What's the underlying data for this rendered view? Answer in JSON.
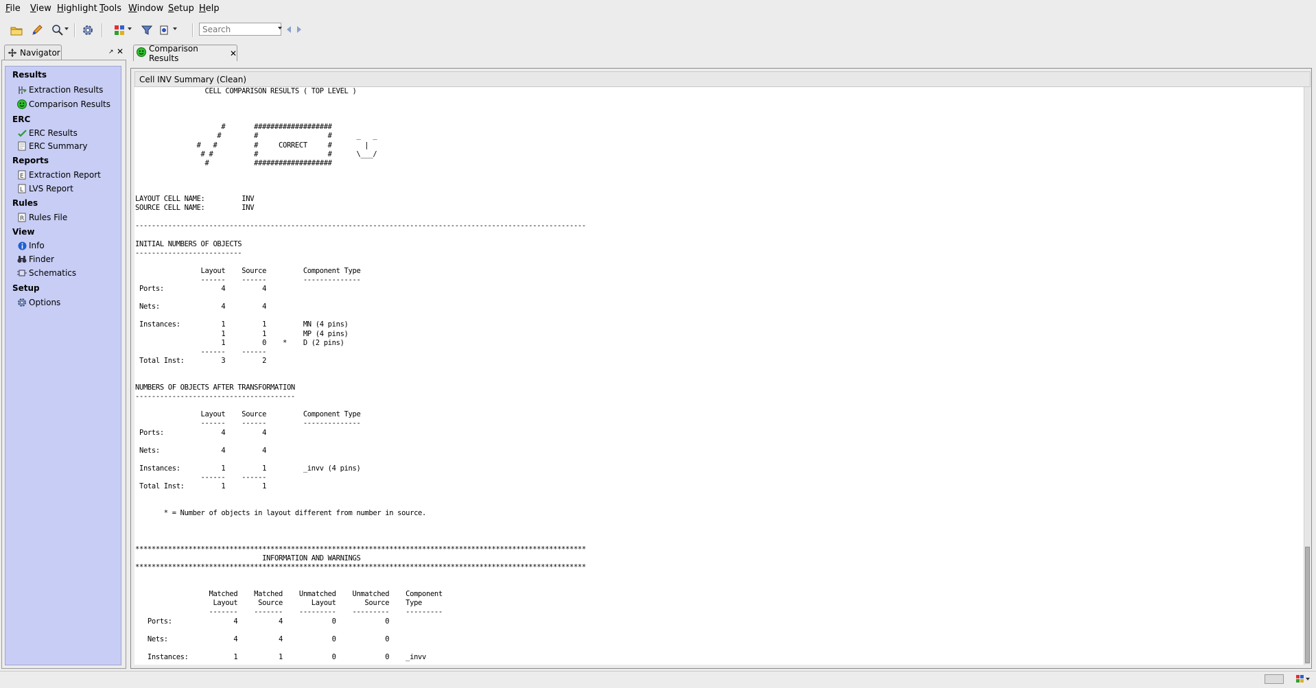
{
  "menubar": {
    "items": [
      {
        "pre": "",
        "ul": "F",
        "post": "ile"
      },
      {
        "pre": "",
        "ul": "V",
        "post": "iew"
      },
      {
        "pre": "",
        "ul": "H",
        "post": "ighlight"
      },
      {
        "pre": "",
        "ul": "T",
        "post": "ools"
      },
      {
        "pre": "",
        "ul": "W",
        "post": "indow"
      },
      {
        "pre": "",
        "ul": "S",
        "post": "etup"
      },
      {
        "pre": "",
        "ul": "H",
        "post": "elp"
      }
    ]
  },
  "toolbar": {
    "search_placeholder": "Search",
    "icons": [
      "open-folder-icon",
      "edit-icon",
      "zoom-icon",
      "settings-icon",
      "highlight-icon",
      "filter-icon",
      "probe-icon"
    ]
  },
  "navigator": {
    "tab_label": "Navigator",
    "sections": [
      {
        "heading": "Results",
        "items": [
          "Extraction Results",
          "Comparison Results"
        ]
      },
      {
        "heading": "ERC",
        "items": [
          "ERC Results",
          "ERC Summary"
        ]
      },
      {
        "heading": "Reports",
        "items": [
          "Extraction Report",
          "LVS Report"
        ]
      },
      {
        "heading": "Rules",
        "items": [
          "Rules File"
        ]
      },
      {
        "heading": "View",
        "items": [
          "Info",
          "Finder",
          "Schematics"
        ]
      },
      {
        "heading": "Setup",
        "items": [
          "Options"
        ]
      }
    ]
  },
  "editor": {
    "tab_label": "Comparison Results",
    "summary_title": "Cell INV Summary (Clean)",
    "report_text": "                 CELL COMPARISON RESULTS ( TOP LEVEL )\n\n\n\n                     #       ###################\n                    #        #                 #      _   _\n               #   #         #     CORRECT     #        |\n                # #          #                 #      \\___/\n                 #           ###################\n\n\n\nLAYOUT CELL NAME:         INV\nSOURCE CELL NAME:         INV\n\n--------------------------------------------------------------------------------------------------------------\n\nINITIAL NUMBERS OF OBJECTS\n--------------------------\n\n                Layout    Source         Component Type\n                ------    ------         --------------\n Ports:              4         4\n\n Nets:               4         4\n\n Instances:          1         1         MN (4 pins)\n                     1         1         MP (4 pins)\n                     1         0    *    D (2 pins)\n                ------    ------\n Total Inst:         3         2\n\n\nNUMBERS OF OBJECTS AFTER TRANSFORMATION\n---------------------------------------\n\n                Layout    Source         Component Type\n                ------    ------         --------------\n Ports:              4         4\n\n Nets:               4         4\n\n Instances:          1         1         _invv (4 pins)\n                ------    ------\n Total Inst:         1         1\n\n\n       * = Number of objects in layout different from number in source.\n\n\n\n**************************************************************************************************************\n                               INFORMATION AND WARNINGS\n**************************************************************************************************************\n\n\n                  Matched    Matched    Unmatched    Unmatched    Component\n                   Layout     Source       Layout       Source    Type\n                  -------    -------    ---------    ---------    ---------\n   Ports:               4          4            0            0\n\n   Nets:                4          4            0            0\n\n   Instances:           1          1            0            0    _invv\n                  -------    -------    ---------    ---------"
  },
  "colors": {
    "navigator_bg": "#c7cdf4",
    "window_bg": "#ececec",
    "report_bg": "#ffffff"
  }
}
